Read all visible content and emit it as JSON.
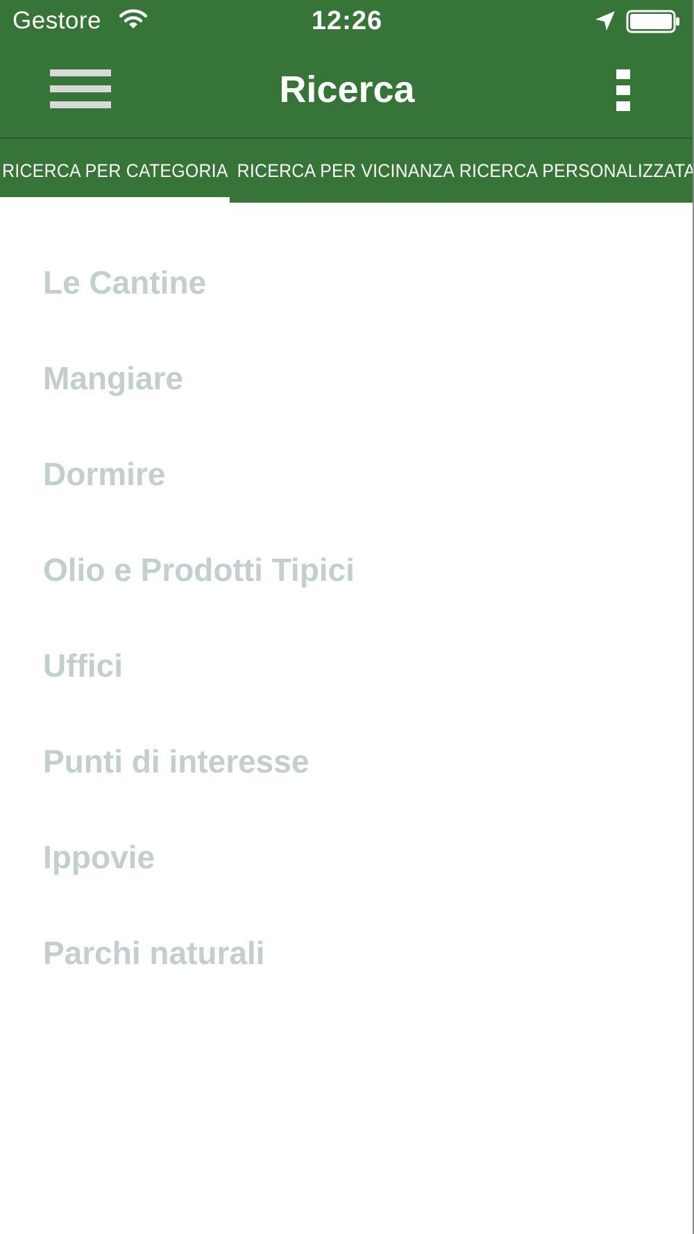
{
  "status_bar": {
    "carrier": "Gestore",
    "time": "12:26",
    "icons": [
      "wifi-icon",
      "location-arrow-icon",
      "battery-icon"
    ]
  },
  "nav_bar": {
    "title": "Ricerca",
    "left_icon": "hamburger-menu-icon",
    "right_icon": "more-vertical-icon"
  },
  "tabs": [
    {
      "label": "RICERCA PER CATEGORIA",
      "selected": true
    },
    {
      "label": "RICERCA PER VICINANZA",
      "selected": false
    },
    {
      "label": "RICERCA PERSONALIZZATA",
      "selected": false
    }
  ],
  "categories": [
    "Le Cantine",
    "Mangiare",
    "Dormire",
    "Olio e Prodotti Tipici",
    "Uffici",
    "Punti di interesse",
    "Ippovie",
    "Parchi naturali"
  ],
  "colors": {
    "primary_green": "#377437",
    "category_text": "#c3cecf",
    "background": "#ffffff"
  }
}
